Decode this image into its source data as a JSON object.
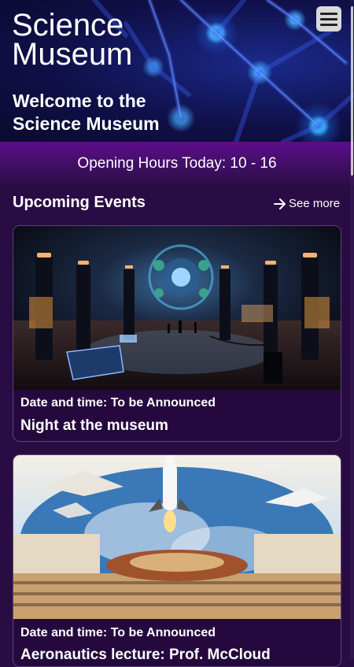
{
  "header": {
    "site_title": "Science Museum",
    "menu_icon": "hamburger-menu-icon",
    "welcome": "Welcome to the Science Museum"
  },
  "hours": {
    "text": "Opening Hours Today: 10 - 16"
  },
  "events": {
    "title": "Upcoming Events",
    "see_more": "See more",
    "see_more_icon": "arrow-right-icon",
    "items": [
      {
        "date": "Date and time: To be Announced",
        "name": "Night at the museum"
      },
      {
        "date": "Date and time: To be Announced",
        "name": "Aeronautics lecture: Prof. McCloud"
      }
    ]
  },
  "colors": {
    "background": "#2a0c44",
    "band": "#5c0d8c",
    "card_border": "#5b4470"
  }
}
